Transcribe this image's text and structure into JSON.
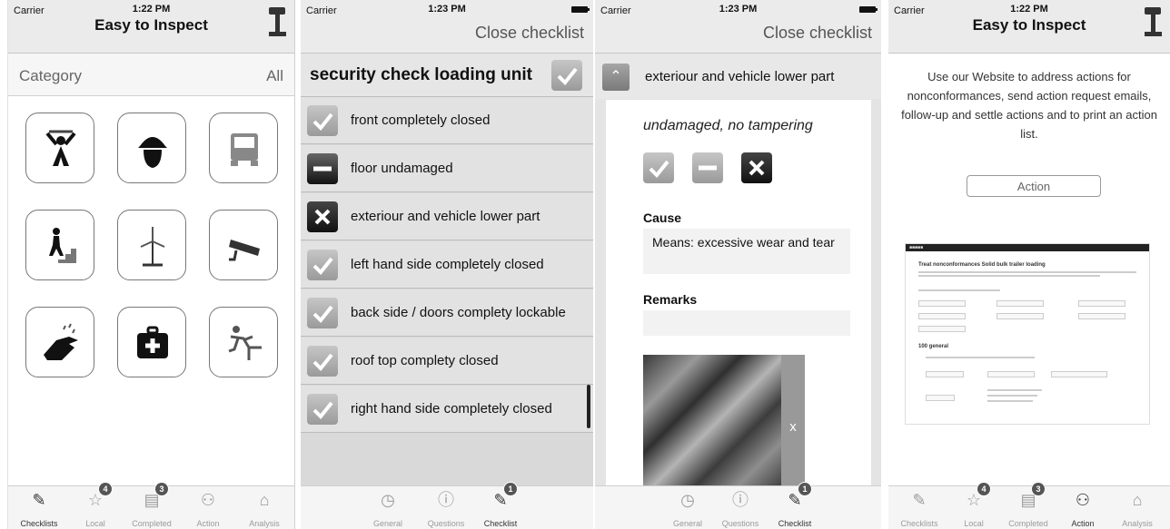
{
  "status": {
    "carrier": "Carrier",
    "times": [
      "1:22 PM",
      "1:23 PM",
      "1:23 PM",
      "1:22 PM"
    ]
  },
  "screen1": {
    "title": "Easy to Inspect",
    "category_label": "Category",
    "category_value": "All",
    "icons": [
      "worker-icon",
      "helmet-icon",
      "truck-icon",
      "stairs-icon",
      "wind-turbine-icon",
      "camera-icon",
      "hand-rain-icon",
      "first-aid-icon",
      "fall-icon"
    ],
    "tabs": [
      {
        "label": "Checklists",
        "icon": "checklist-icon",
        "badge": ""
      },
      {
        "label": "Local",
        "icon": "star-icon",
        "badge": "4"
      },
      {
        "label": "Completed",
        "icon": "completed-icon",
        "badge": "3"
      },
      {
        "label": "Action",
        "icon": "action-icon",
        "badge": ""
      },
      {
        "label": "Analysis",
        "icon": "inbox-icon",
        "badge": ""
      }
    ]
  },
  "screen2": {
    "nav_right": "Close checklist",
    "header": "security check loading unit",
    "rows": [
      {
        "label": "front completely closed",
        "state": "ok"
      },
      {
        "label": "floor undamaged",
        "state": "neutral"
      },
      {
        "label": "exteriour and vehicle lower part",
        "state": "fail"
      },
      {
        "label": "left hand side completely closed",
        "state": "ok"
      },
      {
        "label": "back side / doors complety lockable",
        "state": "ok"
      },
      {
        "label": "roof top complety closed",
        "state": "ok"
      },
      {
        "label": "right hand side completely closed",
        "state": "ok"
      }
    ],
    "tabs": [
      {
        "label": "General",
        "icon": "clock-icon",
        "badge": ""
      },
      {
        "label": "Questions",
        "icon": "info-icon",
        "badge": ""
      },
      {
        "label": "Checklist",
        "icon": "checklist-icon",
        "badge": "1"
      }
    ]
  },
  "screen3": {
    "nav_right": "Close checklist",
    "question": "exteriour and vehicle lower part",
    "answer": "undamaged, no tampering",
    "cause_label": "Cause",
    "cause_text": "Means: excessive wear and tear",
    "remarks_label": "Remarks",
    "photo_close": "x",
    "tabs": [
      {
        "label": "General",
        "icon": "clock-icon",
        "badge": ""
      },
      {
        "label": "Questions",
        "icon": "info-icon",
        "badge": ""
      },
      {
        "label": "Checklist",
        "icon": "checklist-icon",
        "badge": "1"
      }
    ]
  },
  "screen4": {
    "title": "Easy to Inspect",
    "text": "Use our Website to address actions for nonconformances, send action request emails, follow-up and settle actions and to print an action list.",
    "button": "Action",
    "shot_heading": "Treat nonconformances Solid bulk trailer loading",
    "shot_subheading": "100 general",
    "tabs": [
      {
        "label": "Checklists",
        "icon": "checklist-icon",
        "badge": ""
      },
      {
        "label": "Local",
        "icon": "star-icon",
        "badge": "4"
      },
      {
        "label": "Completed",
        "icon": "completed-icon",
        "badge": "3"
      },
      {
        "label": "Action",
        "icon": "action-icon",
        "badge": ""
      },
      {
        "label": "Analysis",
        "icon": "inbox-icon",
        "badge": ""
      }
    ]
  }
}
